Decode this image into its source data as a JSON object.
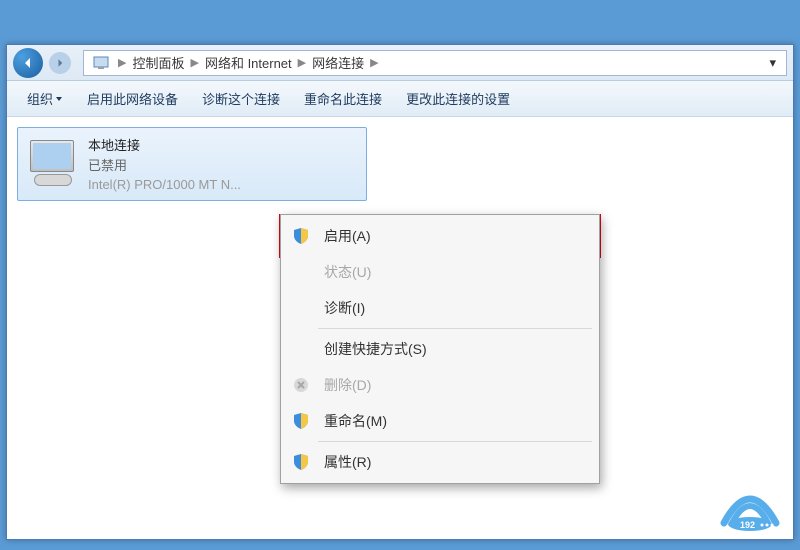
{
  "breadcrumb": {
    "items": [
      "控制面板",
      "网络和 Internet",
      "网络连接"
    ]
  },
  "toolbar": {
    "organize": "组织",
    "enable_device": "启用此网络设备",
    "diagnose": "诊断这个连接",
    "rename": "重命名此连接",
    "change_settings": "更改此连接的设置"
  },
  "connection": {
    "name": "本地连接",
    "status": "已禁用",
    "adapter": "Intel(R) PRO/1000 MT N..."
  },
  "context_menu": {
    "enable": "启用(A)",
    "status": "状态(U)",
    "diagnose": "诊断(I)",
    "create_shortcut": "创建快捷方式(S)",
    "delete": "删除(D)",
    "rename": "重命名(M)",
    "properties": "属性(R)"
  },
  "watermark": {
    "text": "192"
  }
}
